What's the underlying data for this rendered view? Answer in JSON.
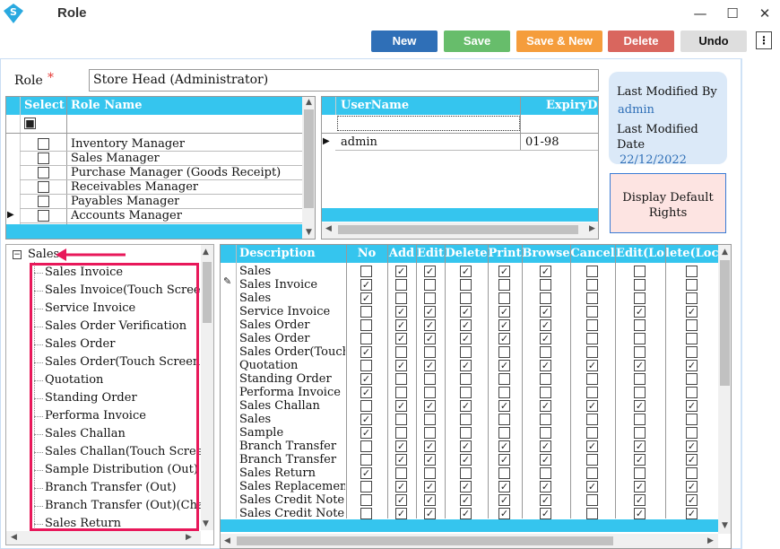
{
  "window": {
    "title": "Role",
    "minimize": "—",
    "maximize": "☐",
    "close": "✕"
  },
  "toolbar": [
    {
      "label": "New",
      "color": "#2f6fb7",
      "name": "new-button"
    },
    {
      "label": "Save",
      "color": "#67bd6b",
      "name": "save-button"
    },
    {
      "label": "Save & New",
      "color": "#f59d3c",
      "name": "save-new-button"
    },
    {
      "label": "Delete",
      "color": "#d9665e",
      "name": "delete-button"
    },
    {
      "label": "Undo",
      "color": "#dedede",
      "name": "undo-button"
    }
  ],
  "role": {
    "label": "Role",
    "required": "*",
    "value": "Store Head (Administrator)"
  },
  "info": {
    "modified_by_label": "Last Modified By",
    "modified_by": "admin",
    "modified_date_label": "Last Modified Date",
    "modified_date": "22/12/2022"
  },
  "default_rights_button": "Display Default Rights",
  "roles_grid": {
    "headers": [
      "Select",
      "Role Name"
    ],
    "rows": [
      {
        "name": "Inventory Manager"
      },
      {
        "name": "Sales Manager"
      },
      {
        "name": "Purchase Manager (Goods Receipt)"
      },
      {
        "name": "Receivables Manager"
      },
      {
        "name": "Payables Manager"
      },
      {
        "name": "Accounts Manager"
      }
    ]
  },
  "users_grid": {
    "headers": [
      "UserName",
      "ExpiryDa"
    ],
    "rows": [
      {
        "user": "admin",
        "expiry": "01-98"
      }
    ]
  },
  "tree": {
    "root": "Sales",
    "items": [
      "Sales Invoice",
      "Sales Invoice(Touch Screen",
      "Service Invoice",
      "Sales Order Verification",
      "Sales Order",
      "Sales Order(Touch Screen)",
      "Quotation",
      "Standing Order",
      "Performa Invoice",
      "Sales Challan",
      "Sales Challan(Touch Screen",
      "Sample Distribution (Out)",
      "Branch Transfer (Out)",
      "Branch Transfer (Out)(Cha",
      "Sales Return"
    ]
  },
  "rights_grid": {
    "headers": [
      "Description",
      "No",
      "Add",
      "Edit",
      "Delete",
      "Print",
      "Browse",
      "Cancel",
      "Edit(Lo",
      "lete(Lock"
    ],
    "rows": [
      {
        "desc": "Sales",
        "checks": [
          0,
          1,
          1,
          1,
          1,
          1,
          0,
          0,
          0
        ]
      },
      {
        "desc": "Sales Invoice",
        "checks": [
          1,
          0,
          0,
          0,
          0,
          0,
          0,
          0,
          0
        ]
      },
      {
        "desc": "Sales",
        "checks": [
          1,
          0,
          0,
          0,
          0,
          0,
          0,
          0,
          0
        ]
      },
      {
        "desc": "Service Invoice",
        "checks": [
          0,
          1,
          1,
          1,
          1,
          1,
          0,
          1,
          1
        ]
      },
      {
        "desc": "Sales Order",
        "checks": [
          0,
          1,
          1,
          1,
          1,
          1,
          0,
          0,
          0
        ]
      },
      {
        "desc": "Sales Order",
        "checks": [
          0,
          1,
          1,
          1,
          1,
          1,
          0,
          0,
          0
        ]
      },
      {
        "desc": "Sales Order(Touch",
        "checks": [
          1,
          0,
          0,
          0,
          0,
          0,
          0,
          0,
          0
        ]
      },
      {
        "desc": "Quotation",
        "checks": [
          0,
          1,
          1,
          1,
          1,
          1,
          1,
          1,
          1
        ]
      },
      {
        "desc": "Standing Order",
        "checks": [
          1,
          0,
          0,
          0,
          0,
          0,
          0,
          0,
          0
        ]
      },
      {
        "desc": "Performa Invoice",
        "checks": [
          1,
          0,
          0,
          0,
          0,
          0,
          0,
          0,
          0
        ]
      },
      {
        "desc": "Sales Challan",
        "checks": [
          0,
          1,
          1,
          1,
          1,
          1,
          1,
          1,
          1
        ]
      },
      {
        "desc": "Sales",
        "checks": [
          1,
          0,
          0,
          0,
          0,
          0,
          0,
          0,
          0
        ]
      },
      {
        "desc": "Sample",
        "checks": [
          1,
          0,
          0,
          0,
          0,
          0,
          0,
          0,
          0
        ]
      },
      {
        "desc": "Branch Transfer",
        "checks": [
          0,
          1,
          1,
          1,
          1,
          1,
          1,
          1,
          1
        ]
      },
      {
        "desc": "Branch Transfer",
        "checks": [
          0,
          1,
          1,
          1,
          1,
          1,
          0,
          1,
          1
        ]
      },
      {
        "desc": "Sales Return",
        "checks": [
          1,
          0,
          0,
          0,
          0,
          0,
          0,
          0,
          0
        ]
      },
      {
        "desc": "Sales Replacement",
        "checks": [
          0,
          1,
          1,
          1,
          1,
          1,
          1,
          1,
          1
        ]
      },
      {
        "desc": "Sales Credit Note",
        "checks": [
          0,
          1,
          1,
          1,
          1,
          1,
          0,
          1,
          1
        ]
      },
      {
        "desc": "Sales Credit Note",
        "checks": [
          0,
          1,
          1,
          1,
          1,
          1,
          0,
          1,
          1
        ]
      }
    ]
  },
  "colors": {
    "header": "#35c5ee",
    "highlight": "#e8185a",
    "accent": "#2f6fb7"
  }
}
